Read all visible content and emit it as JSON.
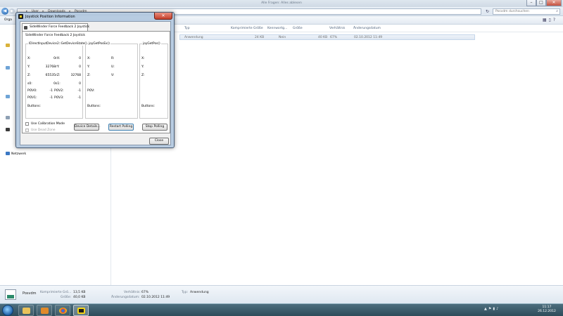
{
  "explorer": {
    "title": "Alle Fragen: Alles ablesen",
    "address": {
      "crumbs": [
        "User",
        "Downloads",
        "Posvdm"
      ]
    },
    "search_placeholder": "Posvdm durchsuchen",
    "toolbar": {
      "organize_label": "Orga"
    },
    "columns": [
      "Typ",
      "Komprimierte Größe",
      "Kennwortg...",
      "Größe",
      "Verhältnis",
      "Änderungsdatum"
    ],
    "file": {
      "type": "Anwendung",
      "compressed": "24 KB",
      "password": "Nein",
      "size": "40 KB",
      "ratio": "67%",
      "modified": "02.10.2012 11:49"
    },
    "nav": {
      "network_label": "Netzwerk"
    },
    "details": {
      "name": "Posvdm",
      "compressed_label": "Komprimierte Grö...",
      "compressed_value": "13,5 KB",
      "size_label": "Größe:",
      "size_value": "40,0 KB",
      "ratio_label": "Verhältnis:",
      "ratio_value": "67%",
      "modified_label": "Änderungsdatum:",
      "modified_value": "02.10.2012 11:49",
      "type_label": "Typ:",
      "type_value": "Anwendung"
    }
  },
  "taskbar": {
    "clock_time": "11:17",
    "clock_date": "26.12.2012",
    "tray_icons": [
      "arrow-up-icon",
      "flag-icon",
      "network-icon",
      "volume-icon"
    ]
  },
  "dialog": {
    "title": "Joystick Position Information",
    "close_label": "✕",
    "tab_label": "SideWinder Force Feedback 2 Joystick",
    "device_name": "SideWinder Force Feedback 2 Joystick",
    "group_state": {
      "title": "IDirectInputDevice2::GetDeviceState()",
      "rows": [
        {
          "l1": "X:",
          "v1": "0",
          "l2": "rX:",
          "v2": "0"
        },
        {
          "l1": "Y:",
          "v1": "32768",
          "l2": "rY:",
          "v2": "0"
        },
        {
          "l1": "Z:",
          "v1": "65535",
          "l2": "rZ:",
          "v2": "32768"
        },
        {
          "l1": "s0:",
          "v1": "0",
          "l2": "s1:",
          "v2": "0"
        },
        {
          "l1": "POV0:",
          "v1": "-1",
          "l2": "POV2:",
          "v2": "-1"
        },
        {
          "l1": "POV1:",
          "v1": "-1",
          "l2": "POV3:",
          "v2": "-1"
        }
      ],
      "buttons_label": "Buttons:"
    },
    "group_posex": {
      "title": "joyGetPosEx()",
      "rows": [
        {
          "l1": "X:",
          "l2": "R:"
        },
        {
          "l1": "Y:",
          "l2": "U:"
        },
        {
          "l1": "Z:",
          "l2": "V:"
        }
      ],
      "pov_label": "POV:",
      "buttons_label": "Buttons:"
    },
    "group_pos": {
      "title": "joyGetPos()",
      "rows": [
        "X:",
        "Y:",
        "Z:"
      ],
      "buttons_label": "Buttons:"
    },
    "calibration_label": "Use Calibration Mode",
    "deadzone_label": "Use Dead Zone",
    "buttons": {
      "device_details": "Device Details...",
      "restart": "Restart Polling",
      "stop": "Stop Polling",
      "close": "Close"
    }
  }
}
